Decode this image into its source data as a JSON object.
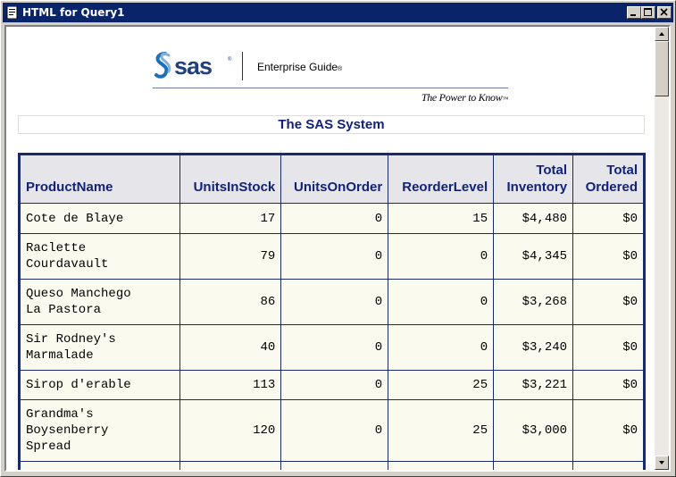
{
  "window": {
    "title": "HTML for Query1"
  },
  "banner": {
    "logo_text": "sas",
    "product": "Enterprise Guide",
    "tagline": "The Power to Know"
  },
  "report": {
    "title": "The SAS System"
  },
  "table": {
    "headers": [
      [
        "ProductName"
      ],
      [
        "UnitsInStock"
      ],
      [
        "UnitsOnOrder"
      ],
      [
        "ReorderLevel"
      ],
      [
        "Total",
        "Inventory"
      ],
      [
        "Total",
        "Ordered"
      ]
    ],
    "rows": [
      {
        "name": [
          "Cote de Blaye"
        ],
        "stock": "17",
        "order": "0",
        "reorder": "15",
        "inventory": "$4,480",
        "ordered": "$0"
      },
      {
        "name": [
          "Raclette",
          "Courdavault"
        ],
        "stock": "79",
        "order": "0",
        "reorder": "0",
        "inventory": "$4,345",
        "ordered": "$0"
      },
      {
        "name": [
          "Queso Manchego",
          "La Pastora"
        ],
        "stock": "86",
        "order": "0",
        "reorder": "0",
        "inventory": "$3,268",
        "ordered": "$0"
      },
      {
        "name": [
          "Sir Rodney's",
          "Marmalade"
        ],
        "stock": "40",
        "order": "0",
        "reorder": "0",
        "inventory": "$3,240",
        "ordered": "$0"
      },
      {
        "name": [
          "Sirop d'erable"
        ],
        "stock": "113",
        "order": "0",
        "reorder": "25",
        "inventory": "$3,221",
        "ordered": "$0"
      },
      {
        "name": [
          "Grandma's",
          "Boysenberry",
          "Spread"
        ],
        "stock": "120",
        "order": "0",
        "reorder": "25",
        "inventory": "$3,000",
        "ordered": "$0"
      },
      {
        "name": [
          ""
        ],
        "stock": "",
        "order": "",
        "reorder": "",
        "inventory": "",
        "ordered": ""
      }
    ]
  },
  "colors": {
    "titlebar": "#0a246a",
    "header_text": "#112277",
    "grid": "#1a2b6b",
    "cell_bg": "#fafaee"
  }
}
